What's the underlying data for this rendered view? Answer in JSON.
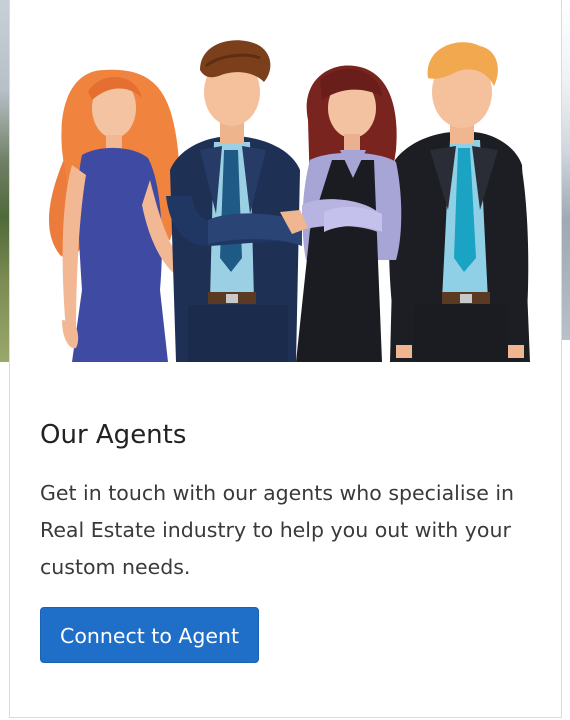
{
  "card": {
    "title": "Our Agents",
    "description": "Get in touch with our agents who specialise in Real Estate industry to help you out with your custom needs.",
    "button_label": "Connect to Agent"
  },
  "colors": {
    "button_bg": "#1f6fc8",
    "title_text": "#222222",
    "body_text": "#3a3a3a"
  }
}
